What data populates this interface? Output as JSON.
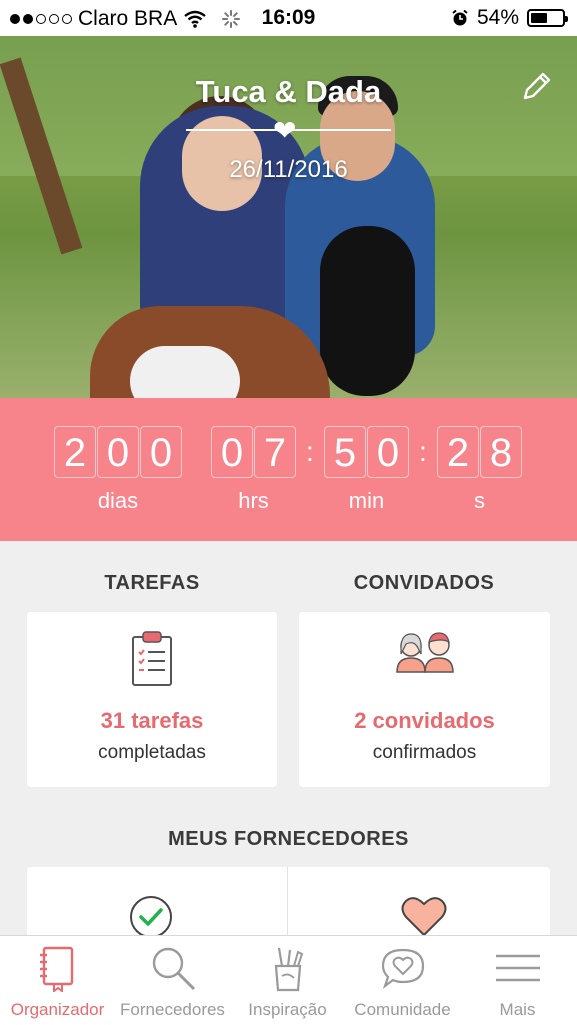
{
  "status_bar": {
    "carrier": "Claro BRA",
    "time": "16:09",
    "battery": "54%",
    "battery_level": 0.54,
    "signal_bars": 2,
    "icons": [
      "wifi-icon",
      "activity-spinner-icon",
      "alarm-icon",
      "battery-icon"
    ]
  },
  "hero": {
    "title": "Tuca & Dada",
    "date": "26/11/2016",
    "edit_icon": "pencil-icon",
    "heart_icon": "heart-icon"
  },
  "countdown": {
    "days": [
      "2",
      "0",
      "0"
    ],
    "hours": [
      "0",
      "7"
    ],
    "minutes": [
      "5",
      "0"
    ],
    "seconds": [
      "2",
      "8"
    ],
    "days_label": "dias",
    "hours_label": "hrs",
    "minutes_label": "min",
    "seconds_label": "s"
  },
  "sections": {
    "tasks": {
      "title": "TAREFAS",
      "count_text": "31 tarefas",
      "sub_text": "completadas",
      "icon": "clipboard-checklist-icon"
    },
    "guests": {
      "title": "CONVIDADOS",
      "count_text": "2 convidados",
      "sub_text": "confirmados",
      "icon": "couple-avatars-icon"
    },
    "vendors": {
      "title": "MEUS FORNECEDORES",
      "left_icon": "check-circle-icon",
      "right_icon": "heart-icon"
    }
  },
  "tabbar": {
    "items": [
      {
        "label": "Organizador",
        "icon": "notebook-icon",
        "active": true
      },
      {
        "label": "Fornecedores",
        "icon": "search-icon",
        "active": false
      },
      {
        "label": "Inspiração",
        "icon": "pencil-cup-icon",
        "active": false
      },
      {
        "label": "Comunidade",
        "icon": "heart-chat-icon",
        "active": false
      },
      {
        "label": "Mais",
        "icon": "menu-icon",
        "active": false
      }
    ]
  },
  "colors": {
    "accent": "#e86a70",
    "countdown_bg": "#f7838b",
    "background": "#efefef"
  }
}
